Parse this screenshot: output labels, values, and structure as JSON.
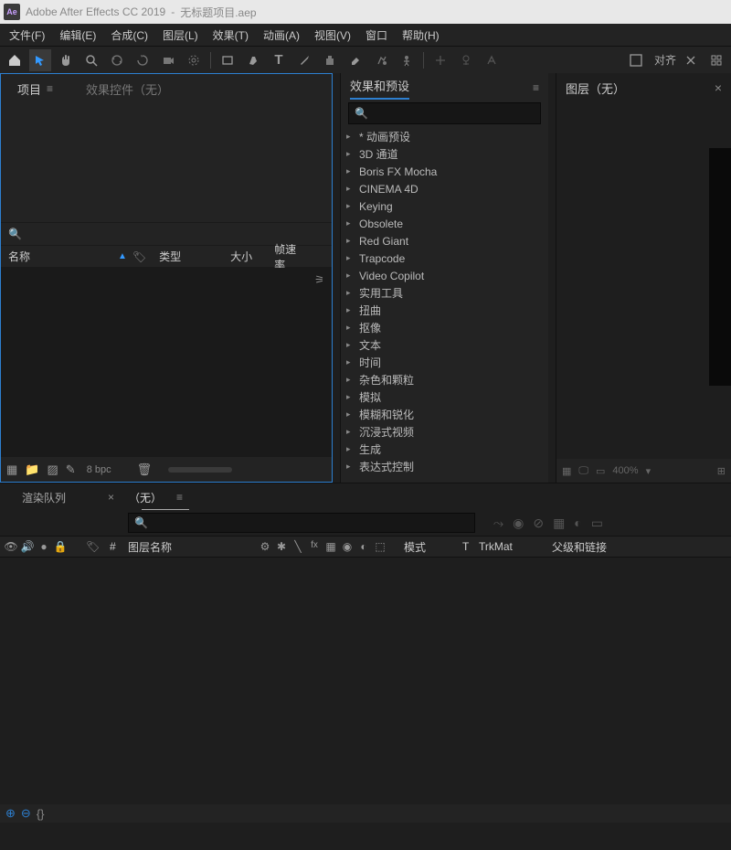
{
  "titlebar": {
    "app": "Adobe After Effects CC 2019",
    "file": "无标题项目.aep",
    "logo": "Ae"
  },
  "menu": {
    "file": "文件(F)",
    "edit": "编辑(E)",
    "composition": "合成(C)",
    "layer": "图层(L)",
    "effect": "效果(T)",
    "animation": "动画(A)",
    "view": "视图(V)",
    "window": "窗口",
    "help": "帮助(H)"
  },
  "toolbar": {
    "snap": "对齐"
  },
  "project": {
    "tab_project": "项目",
    "tab_effect_controls": "效果控件（无）",
    "col_name": "名称",
    "col_type": "类型",
    "col_size": "大小",
    "col_fps": "帧速率",
    "bpc": "8 bpc"
  },
  "effects": {
    "title": "效果和预设",
    "items": [
      "* 动画预设",
      "3D 通道",
      "Boris FX Mocha",
      "CINEMA 4D",
      "Keying",
      "Obsolete",
      "Red Giant",
      "Trapcode",
      "Video Copilot",
      "实用工具",
      "扭曲",
      "抠像",
      "文本",
      "时间",
      "杂色和颗粒",
      "模拟",
      "模糊和锐化",
      "沉浸式视频",
      "生成",
      "表达式控制"
    ]
  },
  "layer_panel": {
    "title": "图层（无）",
    "zoom": "400%"
  },
  "timeline": {
    "tab_render": "渲染队列",
    "tab_none": "（无）",
    "col_layer_name": "图层名称",
    "col_mode": "模式",
    "col_t": "T",
    "col_trkmat": "TrkMat",
    "col_parent": "父级和链接",
    "col_hash": "#"
  }
}
